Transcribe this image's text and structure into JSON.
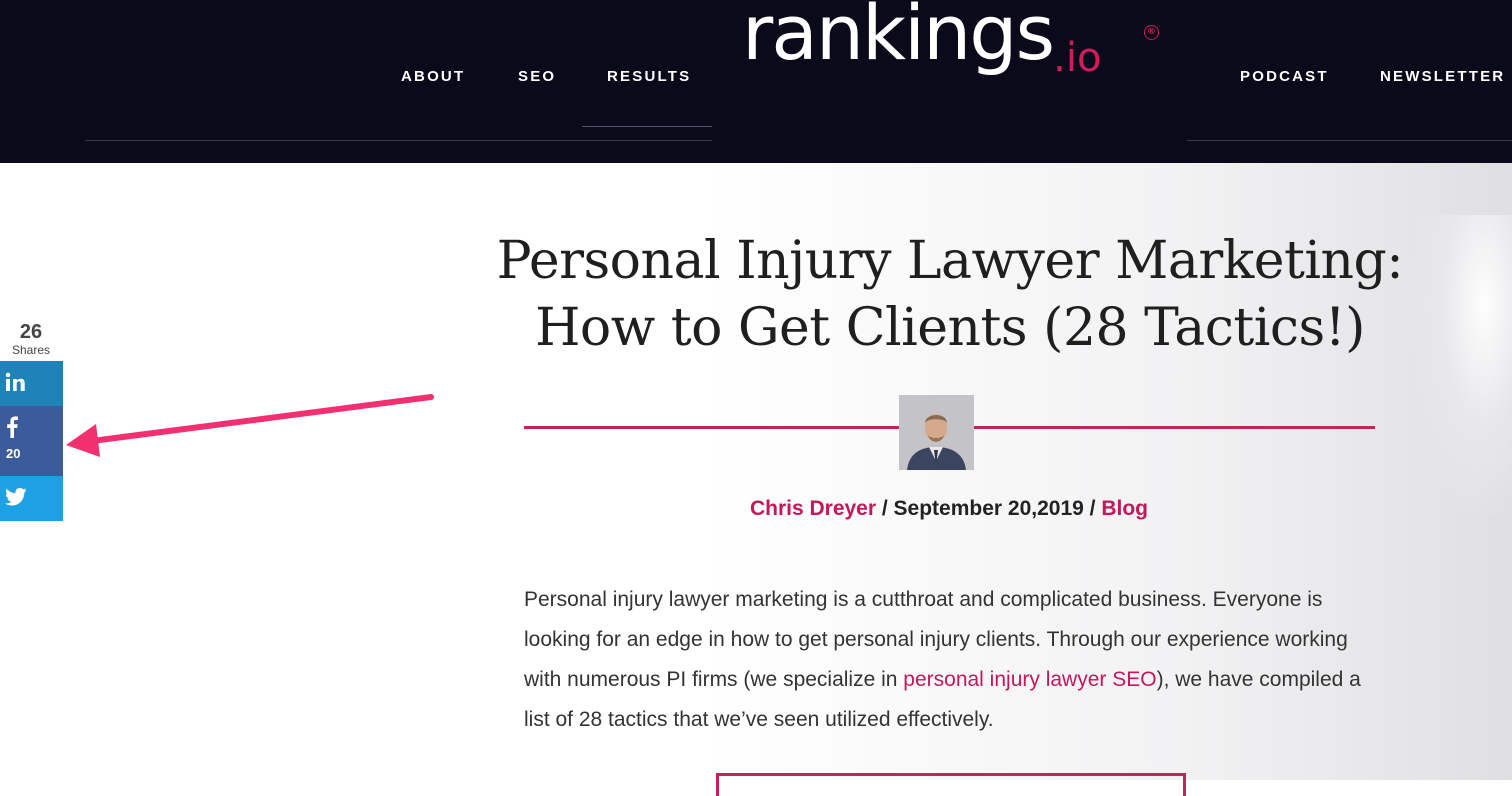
{
  "header": {
    "nav_left": [
      "ABOUT",
      "SEO",
      "RESULTS"
    ],
    "nav_right": [
      "PODCAST",
      "NEWSLETTER"
    ],
    "logo_text": "rankings",
    "logo_suffix": ".io",
    "logo_mark": "®",
    "colors": {
      "background": "#0b0a1a",
      "accent": "#d21c59"
    }
  },
  "share": {
    "total": "26",
    "label": "Shares",
    "linkedin_icon": "linkedin-icon",
    "facebook_icon": "facebook-icon",
    "facebook_count": "20",
    "twitter_icon": "twitter-icon",
    "colors": {
      "linkedin": "#1f82b8",
      "facebook": "#3b5b9d",
      "twitter": "#1da1e2"
    }
  },
  "annotation": {
    "arrow_color": "#f2306f"
  },
  "article": {
    "title_line1": "Personal Injury Lawyer Marketing:",
    "title_line2": "How to Get Clients (28 Tactics!)",
    "author": "Chris Dreyer",
    "separator": " / ",
    "date": "September 20,2019",
    "category": "Blog",
    "intro_before_link": "Personal injury lawyer marketing is a cutthroat and complicated business. Everyone is looking for an edge in how to get personal injury clients. Through our experience working with numerous PI firms (we specialize in ",
    "intro_link": "personal injury lawyer SEO",
    "intro_after_link": "), we have compiled a list of 28 tactics that we’ve seen utilized effectively.",
    "accent_color": "#c9215a"
  }
}
